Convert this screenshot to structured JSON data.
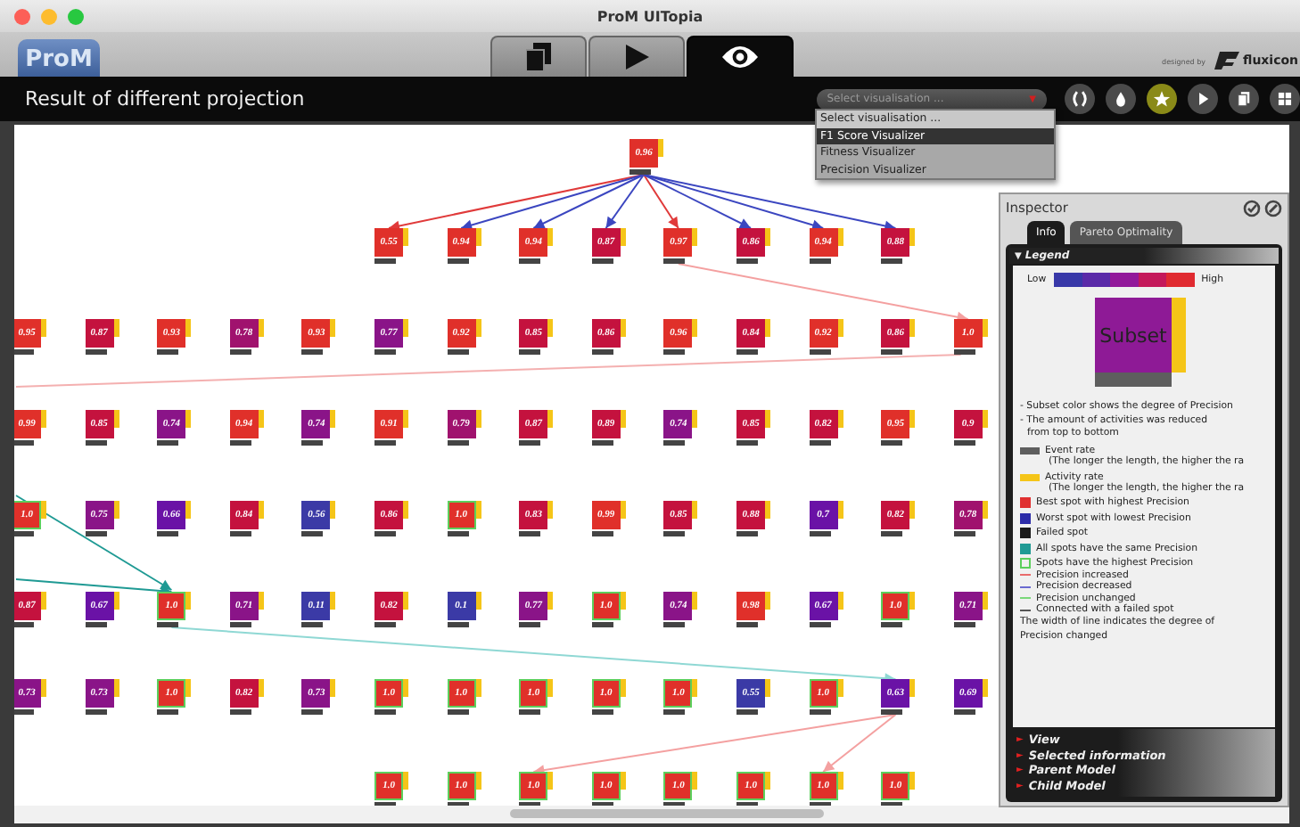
{
  "window": {
    "title": "ProM UITopia"
  },
  "header": {
    "logo": "ProM",
    "tabs": [
      {
        "kind": "documents",
        "selected": false
      },
      {
        "kind": "play",
        "selected": false
      },
      {
        "kind": "eye",
        "selected": true
      }
    ],
    "credit": "designed by",
    "brand": "fluxicon"
  },
  "toolbar": {
    "title": "Result of different projection",
    "select": {
      "placeholder": "Select visualisation ...",
      "caret": "▼"
    },
    "menu": [
      {
        "label": "Select visualisation ...",
        "selected": false
      },
      {
        "label": "F1 Score Visualizer",
        "selected": true
      },
      {
        "label": "Fitness Visualizer",
        "selected": false
      },
      {
        "label": "Precision Visualizer",
        "selected": false
      }
    ],
    "buttons": [
      {
        "kind": "parens",
        "selected": false
      },
      {
        "kind": "drop",
        "selected": false
      },
      {
        "kind": "star",
        "selected": true
      },
      {
        "kind": "play",
        "selected": false
      },
      {
        "kind": "copy",
        "selected": false
      },
      {
        "kind": "grid",
        "selected": false
      }
    ]
  },
  "graph": {
    "rows": [
      {
        "nodes": [
          {
            "value": "0.96",
            "color": "#e0302a",
            "highest": false
          }
        ]
      },
      {
        "nodes": [
          {
            "value": "0.55",
            "color": "#e0302a",
            "highest": false
          },
          {
            "value": "0.94",
            "color": "#e0302a",
            "highest": false
          },
          {
            "value": "0.94",
            "color": "#e0302a",
            "highest": false
          },
          {
            "value": "0.87",
            "color": "#c4123e",
            "highest": false
          },
          {
            "value": "0.97",
            "color": "#e0302a",
            "highest": false
          },
          {
            "value": "0.86",
            "color": "#c4123e",
            "highest": false
          },
          {
            "value": "0.94",
            "color": "#e0302a",
            "highest": false
          },
          {
            "value": "0.88",
            "color": "#c4123e",
            "highest": false
          }
        ]
      },
      {
        "nodes": [
          {
            "value": "0.95",
            "color": "#e0302a",
            "highest": false
          },
          {
            "value": "0.87",
            "color": "#c4123e",
            "highest": false
          },
          {
            "value": "0.93",
            "color": "#e0302a",
            "highest": false
          },
          {
            "value": "0.78",
            "color": "#a0126e",
            "highest": false
          },
          {
            "value": "0.93",
            "color": "#e0302a",
            "highest": false
          },
          {
            "value": "0.77",
            "color": "#8a1488",
            "highest": false
          },
          {
            "value": "0.92",
            "color": "#e0302a",
            "highest": false
          },
          {
            "value": "0.85",
            "color": "#c4123e",
            "highest": false
          },
          {
            "value": "0.86",
            "color": "#c4123e",
            "highest": false
          },
          {
            "value": "0.96",
            "color": "#e0302a",
            "highest": false
          },
          {
            "value": "0.84",
            "color": "#c4123e",
            "highest": false
          },
          {
            "value": "0.92",
            "color": "#e0302a",
            "highest": false
          },
          {
            "value": "0.86",
            "color": "#c4123e",
            "highest": false
          },
          {
            "value": "1.0",
            "color": "#e0302a",
            "highest": false
          }
        ]
      },
      {
        "nodes": [
          {
            "value": "0.99",
            "color": "#e0302a",
            "highest": false
          },
          {
            "value": "0.85",
            "color": "#c4123e",
            "highest": false
          },
          {
            "value": "0.74",
            "color": "#8a1488",
            "highest": false
          },
          {
            "value": "0.94",
            "color": "#e0302a",
            "highest": false
          },
          {
            "value": "0.74",
            "color": "#8a1488",
            "highest": false
          },
          {
            "value": "0.91",
            "color": "#e0302a",
            "highest": false
          },
          {
            "value": "0.79",
            "color": "#a0126e",
            "highest": false
          },
          {
            "value": "0.87",
            "color": "#c4123e",
            "highest": false
          },
          {
            "value": "0.89",
            "color": "#c4123e",
            "highest": false
          },
          {
            "value": "0.74",
            "color": "#8a1488",
            "highest": false
          },
          {
            "value": "0.85",
            "color": "#c4123e",
            "highest": false
          },
          {
            "value": "0.82",
            "color": "#c4123e",
            "highest": false
          },
          {
            "value": "0.95",
            "color": "#e0302a",
            "highest": false
          },
          {
            "value": "0.9",
            "color": "#c4123e",
            "highest": false
          }
        ]
      },
      {
        "nodes": [
          {
            "value": "1.0",
            "color": "#e0302a",
            "highest": true
          },
          {
            "value": "0.75",
            "color": "#8a1488",
            "highest": false
          },
          {
            "value": "0.66",
            "color": "#6a12a6",
            "highest": false
          },
          {
            "value": "0.84",
            "color": "#c4123e",
            "highest": false
          },
          {
            "value": "0.56",
            "color": "#3b3aa6",
            "highest": false
          },
          {
            "value": "0.86",
            "color": "#c4123e",
            "highest": false
          },
          {
            "value": "1.0",
            "color": "#e0302a",
            "highest": true
          },
          {
            "value": "0.83",
            "color": "#c4123e",
            "highest": false
          },
          {
            "value": "0.99",
            "color": "#e0302a",
            "highest": false
          },
          {
            "value": "0.85",
            "color": "#c4123e",
            "highest": false
          },
          {
            "value": "0.88",
            "color": "#c4123e",
            "highest": false
          },
          {
            "value": "0.7",
            "color": "#6a12a6",
            "highest": false
          },
          {
            "value": "0.82",
            "color": "#c4123e",
            "highest": false
          },
          {
            "value": "0.78",
            "color": "#a0126e",
            "highest": false
          }
        ]
      },
      {
        "nodes": [
          {
            "value": "0.87",
            "color": "#c4123e",
            "highest": false
          },
          {
            "value": "0.67",
            "color": "#6a12a6",
            "highest": false
          },
          {
            "value": "1.0",
            "color": "#e0302a",
            "highest": true
          },
          {
            "value": "0.71",
            "color": "#8a1488",
            "highest": false
          },
          {
            "value": "0.11",
            "color": "#3b3aa6",
            "highest": false
          },
          {
            "value": "0.82",
            "color": "#c4123e",
            "highest": false
          },
          {
            "value": "0.1",
            "color": "#3b3aa6",
            "highest": false
          },
          {
            "value": "0.77",
            "color": "#8a1488",
            "highest": false
          },
          {
            "value": "1.0",
            "color": "#e0302a",
            "highest": true
          },
          {
            "value": "0.74",
            "color": "#8a1488",
            "highest": false
          },
          {
            "value": "0.98",
            "color": "#e0302a",
            "highest": false
          },
          {
            "value": "0.67",
            "color": "#6a12a6",
            "highest": false
          },
          {
            "value": "1.0",
            "color": "#e0302a",
            "highest": true
          },
          {
            "value": "0.71",
            "color": "#8a1488",
            "highest": false
          }
        ]
      },
      {
        "nodes": [
          {
            "value": "0.73",
            "color": "#8a1488",
            "highest": false
          },
          {
            "value": "0.73",
            "color": "#8a1488",
            "highest": false
          },
          {
            "value": "1.0",
            "color": "#e0302a",
            "highest": true
          },
          {
            "value": "0.82",
            "color": "#c4123e",
            "highest": false
          },
          {
            "value": "0.73",
            "color": "#8a1488",
            "highest": false
          },
          {
            "value": "1.0",
            "color": "#e0302a",
            "highest": true
          },
          {
            "value": "1.0",
            "color": "#e0302a",
            "highest": true
          },
          {
            "value": "1.0",
            "color": "#e0302a",
            "highest": true
          },
          {
            "value": "1.0",
            "color": "#e0302a",
            "highest": true
          },
          {
            "value": "1.0",
            "color": "#e0302a",
            "highest": true
          },
          {
            "value": "0.55",
            "color": "#3b3aa6",
            "highest": false
          },
          {
            "value": "1.0",
            "color": "#e0302a",
            "highest": true
          },
          {
            "value": "0.63",
            "color": "#6a12a6",
            "highest": false
          },
          {
            "value": "0.69",
            "color": "#6a12a6",
            "highest": false
          }
        ]
      },
      {
        "nodes": [
          {
            "value": "1.0",
            "color": "#e0302a",
            "highest": true
          },
          {
            "value": "1.0",
            "color": "#e0302a",
            "highest": true
          },
          {
            "value": "1.0",
            "color": "#e0302a",
            "highest": true
          },
          {
            "value": "1.0",
            "color": "#e0302a",
            "highest": true
          },
          {
            "value": "1.0",
            "color": "#e0302a",
            "highest": true
          },
          {
            "value": "1.0",
            "color": "#e0302a",
            "highest": true
          },
          {
            "value": "1.0",
            "color": "#e0302a",
            "highest": true
          },
          {
            "value": "1.0",
            "color": "#e0302a",
            "highest": true
          }
        ]
      }
    ]
  },
  "inspector": {
    "title": "Inspector",
    "tabs": [
      {
        "label": "Info",
        "selected": true
      },
      {
        "label": "Pareto Optimality",
        "selected": false
      }
    ],
    "legend": {
      "toggle": "▼",
      "title": "Legend",
      "low": "Low",
      "high": "High",
      "subset": "Subset",
      "notes": [
        "- Subset color shows the degree of Precision",
        "- The amount of activities was reduced",
        "from top to bottom"
      ],
      "items": [
        {
          "kind": "bar",
          "color": "#5e5e5e",
          "label": "Event rate",
          "detail": "(The longer the length, the higher the ra"
        },
        {
          "kind": "bar",
          "color": "#f5c518",
          "label": "Activity rate",
          "detail": "(The longer the length, the higher the ra"
        },
        {
          "kind": "square",
          "color": "#e03030",
          "label": "Best spot with highest Precision"
        },
        {
          "kind": "square",
          "color": "#2c2ca8",
          "label": "Worst spot with lowest Precision"
        },
        {
          "kind": "square",
          "color": "#1a1a1a",
          "label": "Failed spot"
        },
        {
          "kind": "square",
          "color": "#1f9a94",
          "label": "All spots have the same Precision"
        },
        {
          "kind": "outline",
          "color": "#5ccf5c",
          "label": "Spots have the highest Precision"
        },
        {
          "kind": "line",
          "color": "#e86a6a",
          "label": "Precision increased"
        },
        {
          "kind": "line",
          "color": "#6a6ad0",
          "label": "Precision decreased"
        },
        {
          "kind": "line",
          "color": "#7ad87a",
          "label": "Precision unchanged"
        },
        {
          "kind": "line",
          "color": "#555555",
          "label": "Connected with a failed spot"
        }
      ],
      "footer": "The width of line indicates the degree of Precision changed"
    },
    "sections": [
      {
        "marker": "►",
        "label": "View"
      },
      {
        "marker": "►",
        "label": "Selected information"
      },
      {
        "marker": "►",
        "label": "Parent Model"
      },
      {
        "marker": "►",
        "label": "Child Model"
      }
    ]
  }
}
